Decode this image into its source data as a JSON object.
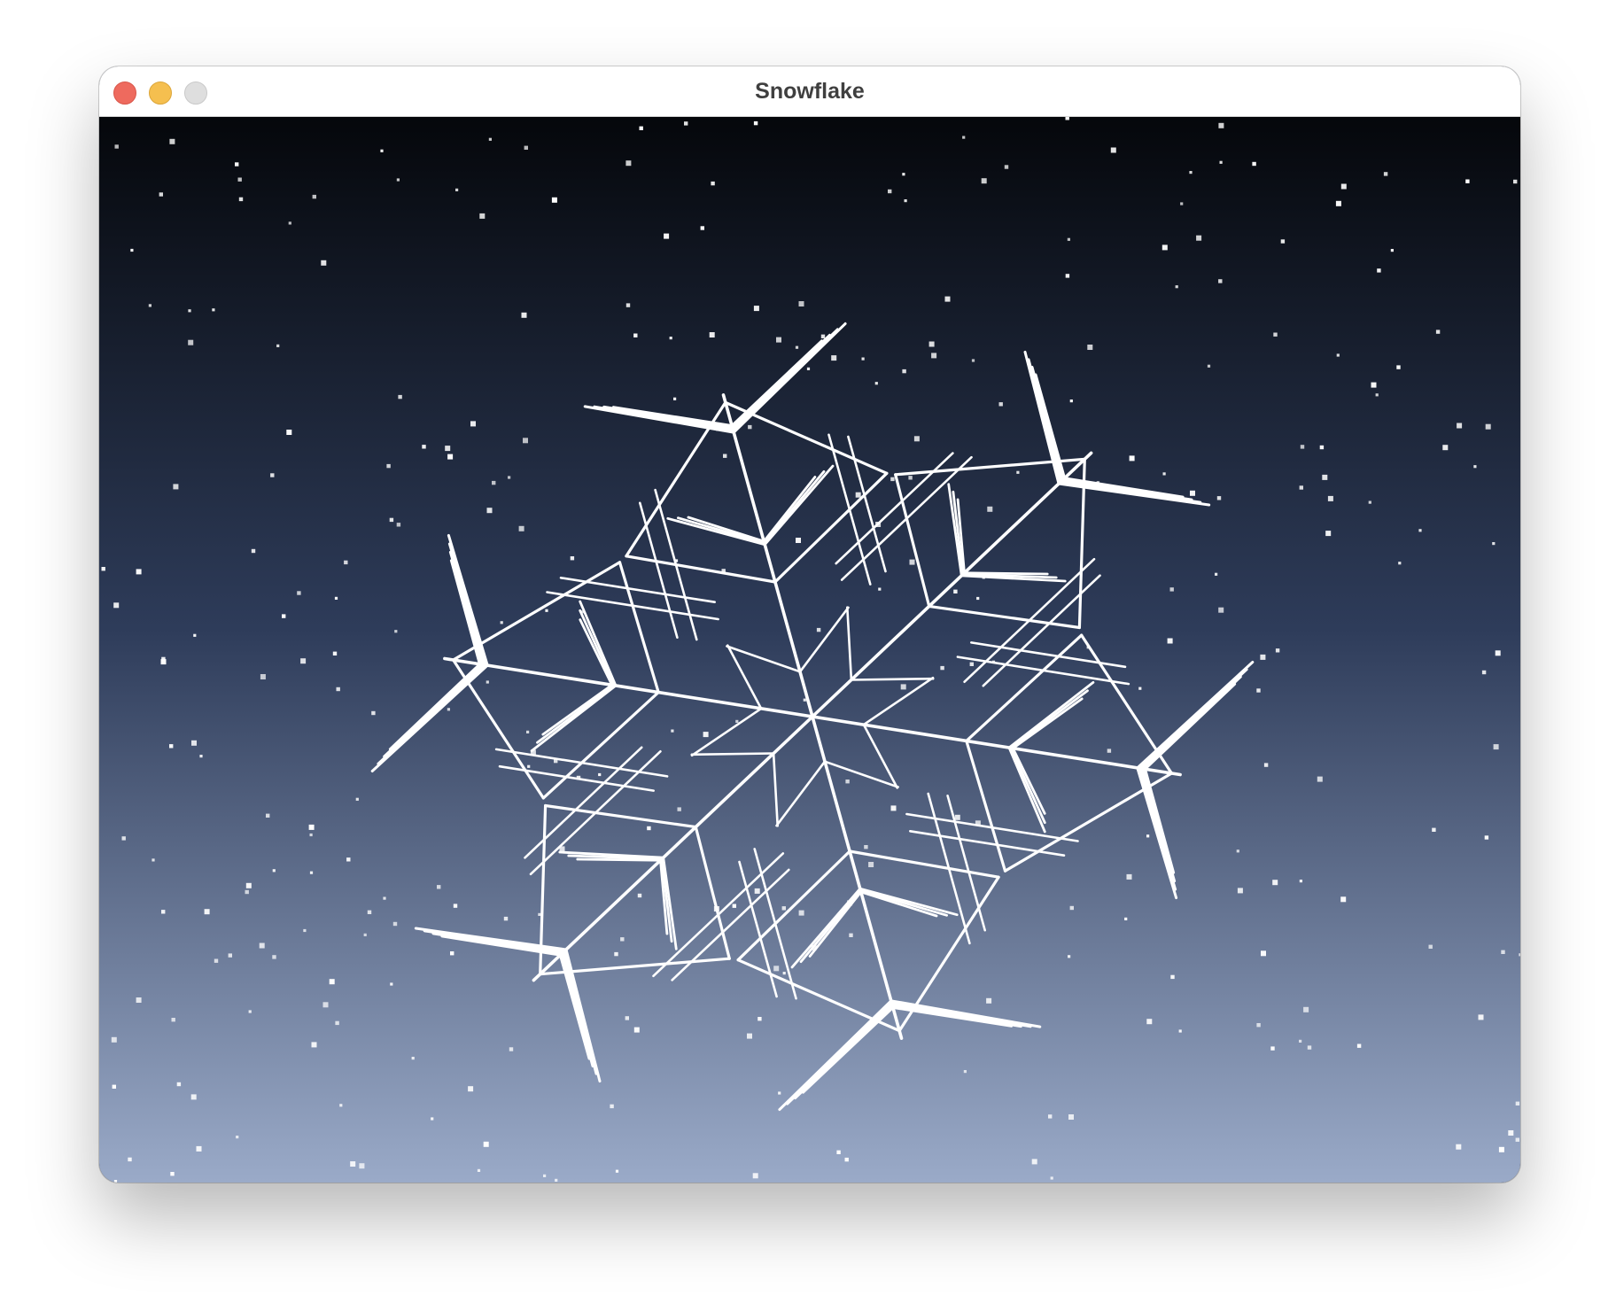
{
  "window": {
    "title": "Snowflake",
    "controls": {
      "close": "close-button",
      "minimize": "minimize-button",
      "zoom": "zoom-button"
    }
  },
  "scene": {
    "sky_top_color": "#05070b",
    "sky_mid_color": "#2e3c5a",
    "sky_bottom_color": "#9aaac8",
    "snowflake_color": "#ffffff",
    "star_color": "#ffffff",
    "snowflake_arms": 6
  }
}
